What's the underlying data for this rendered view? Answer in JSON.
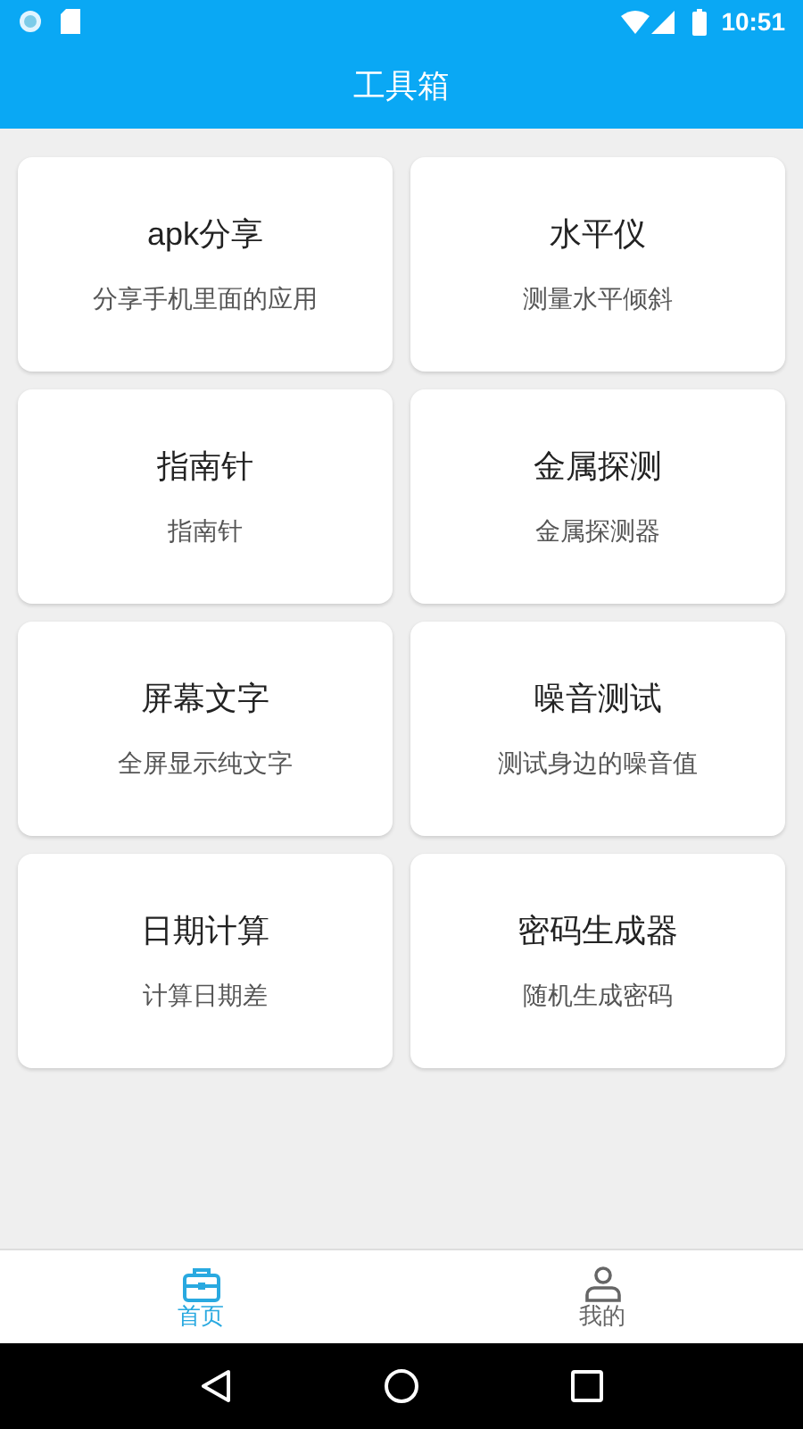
{
  "status_bar": {
    "time": "10:51"
  },
  "app_bar": {
    "title": "工具箱"
  },
  "tools": [
    {
      "title": "apk分享",
      "subtitle": "分享手机里面的应用"
    },
    {
      "title": "水平仪",
      "subtitle": "测量水平倾斜"
    },
    {
      "title": "指南针",
      "subtitle": "指南针"
    },
    {
      "title": "金属探测",
      "subtitle": "金属探测器"
    },
    {
      "title": "屏幕文字",
      "subtitle": "全屏显示纯文字"
    },
    {
      "title": "噪音测试",
      "subtitle": "测试身边的噪音值"
    },
    {
      "title": "日期计算",
      "subtitle": "计算日期差"
    },
    {
      "title": "密码生成器",
      "subtitle": "随机生成密码"
    }
  ],
  "bottom_nav": [
    {
      "label": "首页",
      "selected": true
    },
    {
      "label": "我的",
      "selected": false
    }
  ]
}
